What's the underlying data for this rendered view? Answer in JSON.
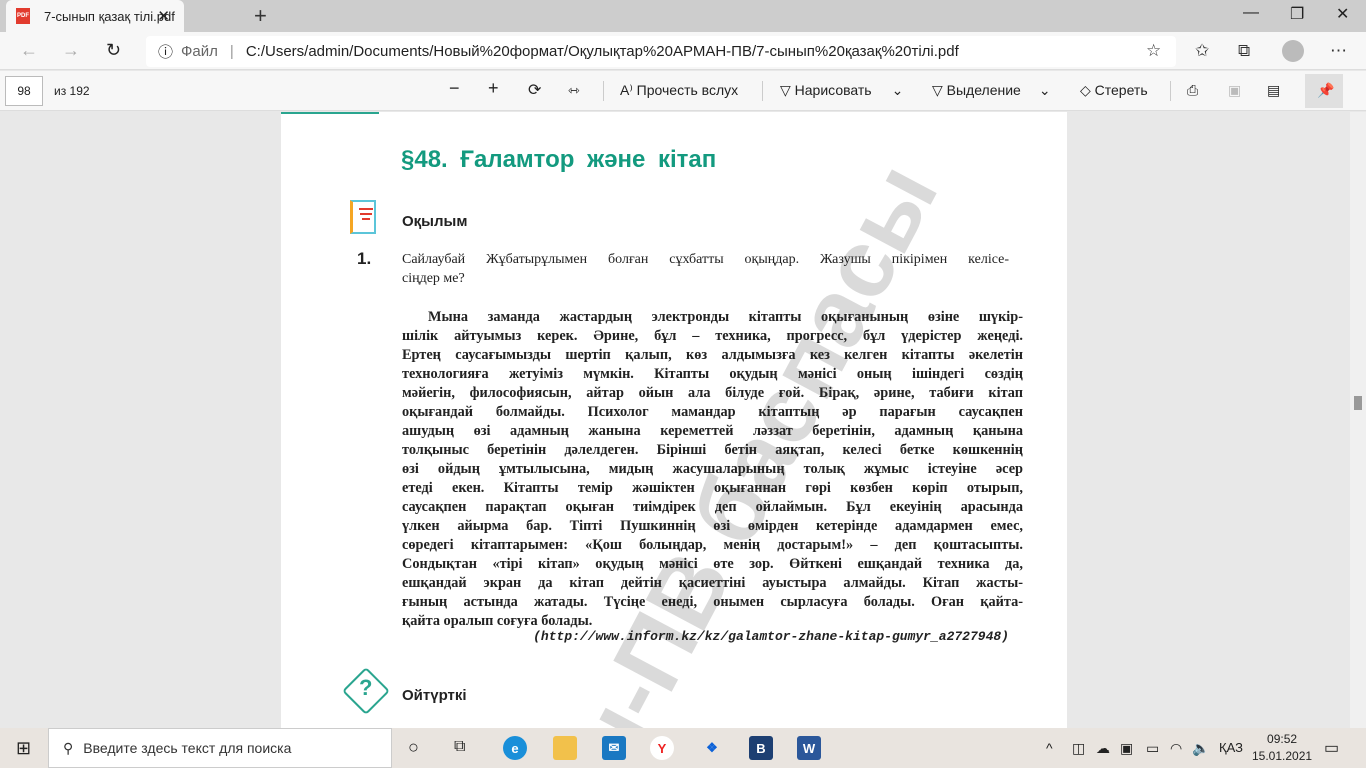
{
  "browser": {
    "tab_title": "7-сынып қазақ тілі.pdf",
    "tab_icon_label": "PDF",
    "address_label": "Файл",
    "url": "C:/Users/admin/Documents/Новый%20формат/Оқулықтар%20АРМАН-ПВ/7-сынып%20қазақ%20тілі.pdf"
  },
  "pdf_toolbar": {
    "page_number": "98",
    "page_total": "из 192",
    "read_aloud": "Прочесть вслух",
    "draw": "Нарисовать",
    "highlight": "Выделение",
    "erase": "Стереть"
  },
  "document": {
    "title": "§48.  Ғаламтор және кітап",
    "section": "Оқылым",
    "task_number": "1.",
    "task_lines": [
      "Сайлаубай Жұбатырұлымен болған сұхбатты оқыңдар. Жазушы пікірімен келісе-",
      "сіңдер ме?"
    ],
    "paragraph_lines": [
      "Мына заманда жастардың электронды кітапты оқығанының өзіне шүкір-",
      "шілік айтуымыз керек. Әрине, бұл – техника, прогресс, бұл үдерістер жеңеді.",
      "Ертең саусағымызды шертіп қалып, көз алдымызға кез келген кітапты әкелетін",
      "технологияға жетуіміз мүмкін. Кітапты оқудың мәнісі оның ішіндегі сөздің",
      "мәйегін, философиясын, айтар ойын ала білуде ғой. Бірақ, әрине, табиғи кітап",
      "оқығандай болмайды. Психолог мамандар кітаптың әр парағын саусақпен",
      "ашудың өзі адамның жанына кереметтей ләззат беретінін, адамның қанына",
      "толқыныс беретінін дәлелдеген. Бірінші бетін аяқтап, келесі бетке көшкеннің",
      "өзі ойдың ұмтылысына, мидың жасушаларының толық жұмыс істеуіне әсер",
      "етеді екен. Кітапты темір жәшіктен оқығаннан гөрі көзбен көріп отырып,",
      "саусақпен парақтап оқыған тиімдірек деп ойлаймын. Бұл екеуінің арасында",
      "үлкен айырма бар. Тіпті Пушкиннің өзі өмірден кетерінде адамдармен емес,",
      "сөредегі кітаптарымен: «Қош болыңдар, менің достарым!» – деп қоштасыпты.",
      "Сондықтан «тірі кітап» оқудың мәнісі өте зор. Өйткені ешқандай техника да,",
      "ешқандай экран да кітап дейтін қасиеттіні ауыстыра алмайды. Кітап жасты-",
      "ғының астында жатады. Түсіңе енеді, онымен сырласуға болады. Оған қайта-",
      "қайта оралып соғуға болады."
    ],
    "source": "(http://www.inform.kz/kz/galamtor-zhane-kitap-gumyr_a2727948)",
    "next_section": "Ойтүрткі",
    "question_mark": "?",
    "watermark": "н-ПВ баспасы"
  },
  "taskbar": {
    "search_placeholder": "Введите здесь текст для поиска",
    "language": "ҚАЗ",
    "time": "09:52",
    "date": "15.01.2021"
  }
}
